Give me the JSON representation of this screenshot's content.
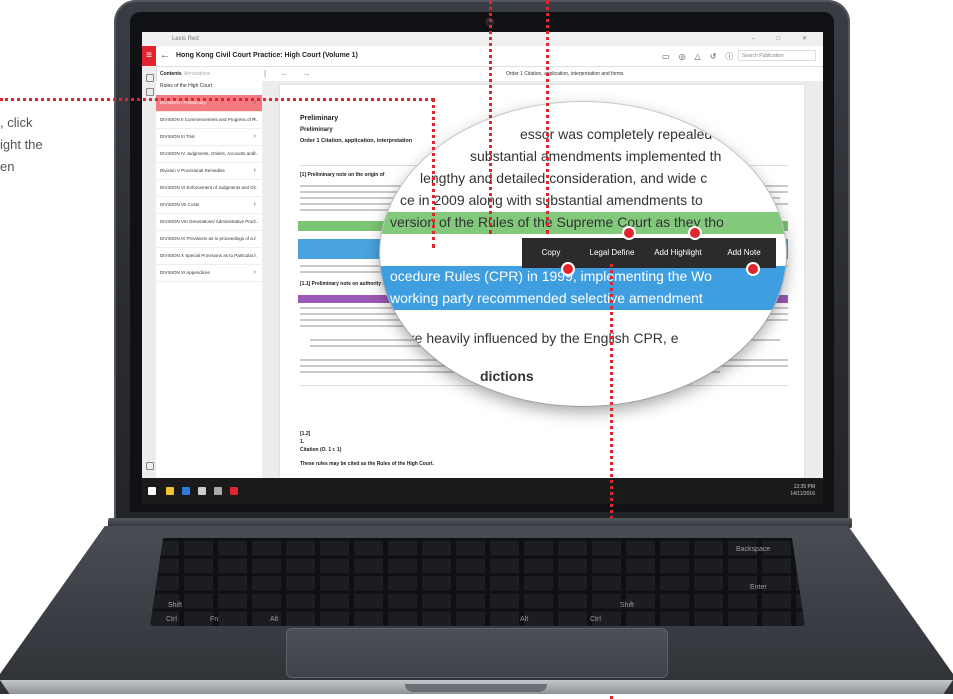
{
  "callout": {
    "lines": [
      ", click",
      "ight the",
      "en"
    ]
  },
  "app": {
    "title": "Lexis Red",
    "window_controls": "– □ ✕",
    "publication_title": "Hong Kong Civil Court Practice: High Court (Volume 1)",
    "search_placeholder": "Search Publication",
    "tabs": {
      "contents": "Contents",
      "annotations": "Annotations"
    },
    "breadcrumb": "Order 1 Citation, application, interpretation and forms"
  },
  "sidebar": {
    "heading": "Rules of the High Court",
    "items": [
      {
        "label": "DIVISION I Preliminary",
        "active": true
      },
      {
        "label": "DIVISION II Commencement and Progress of P...",
        "active": false
      },
      {
        "label": "DIVISION III Trial",
        "active": false
      },
      {
        "label": "DIVISION IV Judgments, Orders, Accounts and...",
        "active": false
      },
      {
        "label": "Division V Provisional Remedies",
        "active": false
      },
      {
        "label": "DIVISION VI Enforcement of Judgments and O...",
        "active": false
      },
      {
        "label": "DIVISION VII Costs",
        "active": false
      },
      {
        "label": "DIVISION VIII Generations/ Administrative Proc...",
        "active": false
      },
      {
        "label": "DIVISION IX Provisions as to proceedings of a...",
        "active": false
      },
      {
        "label": "DIVISION X Special Provisions as to Particular...",
        "active": false
      },
      {
        "label": "DIVISION XI Appendices",
        "active": false
      }
    ]
  },
  "document": {
    "h1": "Preliminary",
    "h2": "Preliminary",
    "h3": "Order 1 Citation, application, interpretation",
    "note_heading": "[1] Preliminary note on the origin of",
    "sub_heading": "[1.1] Preliminary note on authority of",
    "section_ref": "[1.2]",
    "section_num": "1.",
    "section_title": "Citation (O. 1 r. 1)",
    "section_body": "These rules may be cited as the Rules of the High Court."
  },
  "lens": {
    "line1": "essor was completely repealed and re",
    "line2": "substantial amendments implemented th",
    "line3": "lengthy and detailed consideration, and wide c",
    "line4": "ce in 2009 along with substantial amendments to",
    "line5": "version of the Rules of the Supreme Court as they tho",
    "line6": "ocedure Rules (CPR) in 1999, implementing the Wo",
    "line7": "working party recommended selective amendment",
    "line8": "re heavily influenced by the English CPR, e",
    "line9": "dictions",
    "buttons": [
      "Copy",
      "Legal Define",
      "Add Highlight",
      "Add Note"
    ]
  },
  "taskbar": {
    "time": "12:35 PM",
    "date": "14/11/2016"
  },
  "keyboard": {
    "keys": [
      "Backspace",
      "Enter",
      "Shift",
      "Shift",
      "Ctrl",
      "Alt",
      "Alt",
      "Ctrl",
      "Fn"
    ]
  },
  "colors": {
    "accent": "#e0252f",
    "highlight_green": "#7cc576",
    "highlight_blue": "#4aa3df",
    "highlight_purple": "#9b59b6"
  }
}
